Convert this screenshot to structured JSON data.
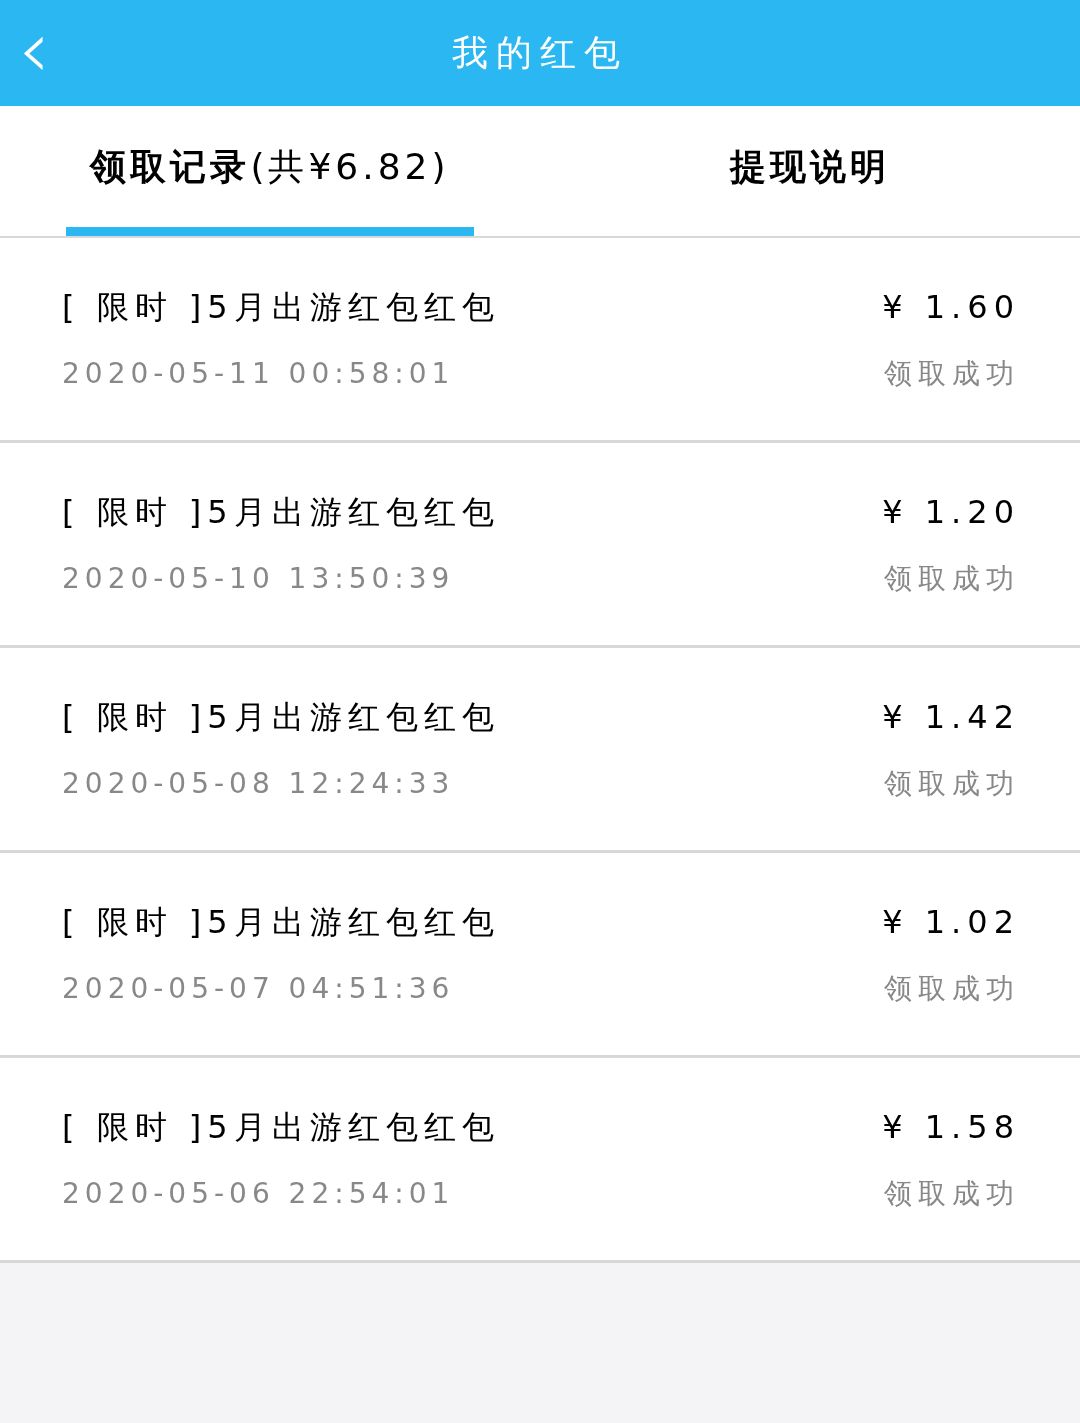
{
  "header": {
    "title": "我的红包",
    "back": "‹"
  },
  "tabs": [
    {
      "label": "**领取记录**(共¥6.82)",
      "selected": true
    },
    {
      "label": "提现说明",
      "selected": false
    }
  ],
  "records": [
    {
      "title": "[ 限时 ]5月出游红包红包",
      "time": "2020-05-11 00:58:01",
      "amount": "¥ 1.60",
      "status": "领取成功"
    },
    {
      "title": "[ 限时 ]5月出游红包红包",
      "time": "2020-05-10 13:50:39",
      "amount": "¥ 1.20",
      "status": "领取成功"
    },
    {
      "title": "[ 限时 ]5月出游红包红包",
      "time": "2020-05-08 12:24:33",
      "amount": "¥ 1.42",
      "status": "领取成功"
    },
    {
      "title": "[ 限时 ]5月出游红包红包",
      "time": "2020-05-07 04:51:36",
      "amount": "¥ 1.02",
      "status": "领取成功"
    },
    {
      "title": "[ 限时 ]5月出游红包红包",
      "time": "2020-05-06 22:54:01",
      "amount": "¥ 1.58",
      "status": "领取成功"
    }
  ]
}
